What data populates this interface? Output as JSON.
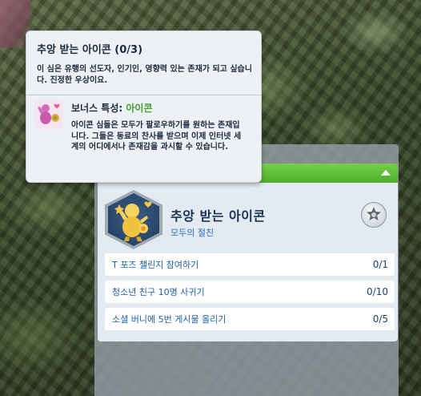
{
  "tooltip": {
    "title": "추앙 받는 아이콘 (0/3)",
    "description": "이 심은 유행의 선도자, 인기인, 영향력 있는 존재가 되고 싶습니다. 진정한 우상이요.",
    "bonus_label": "보너스 특성:",
    "bonus_trait": "아이콘",
    "bonus_description": "아이콘 심들은 모두가 팔로우하기를 원하는 존재입니다. 그들은 동료의 찬사를 받으며 이제 인터넷 세계의 어디에서나 존재감을 과시할 수 있습니다."
  },
  "goal": {
    "title": "추앙 받는 아이콘",
    "subtitle": "모두의 절친",
    "icon": "popular-icon-figure-icon",
    "reward_icon": "star-badge-icon"
  },
  "tasks": [
    {
      "label": "T 포즈 챌린지 참여하기",
      "progress": "0/1"
    },
    {
      "label": "청소년 친구 10명 사귀기",
      "progress": "0/10"
    },
    {
      "label": "소셜 버니에 5번 게시물 올리기",
      "progress": "0/5"
    }
  ],
  "colors": {
    "header_green": "#5cbf36",
    "trait_green": "#3e9e2a",
    "link_blue": "#1d5fa8"
  }
}
